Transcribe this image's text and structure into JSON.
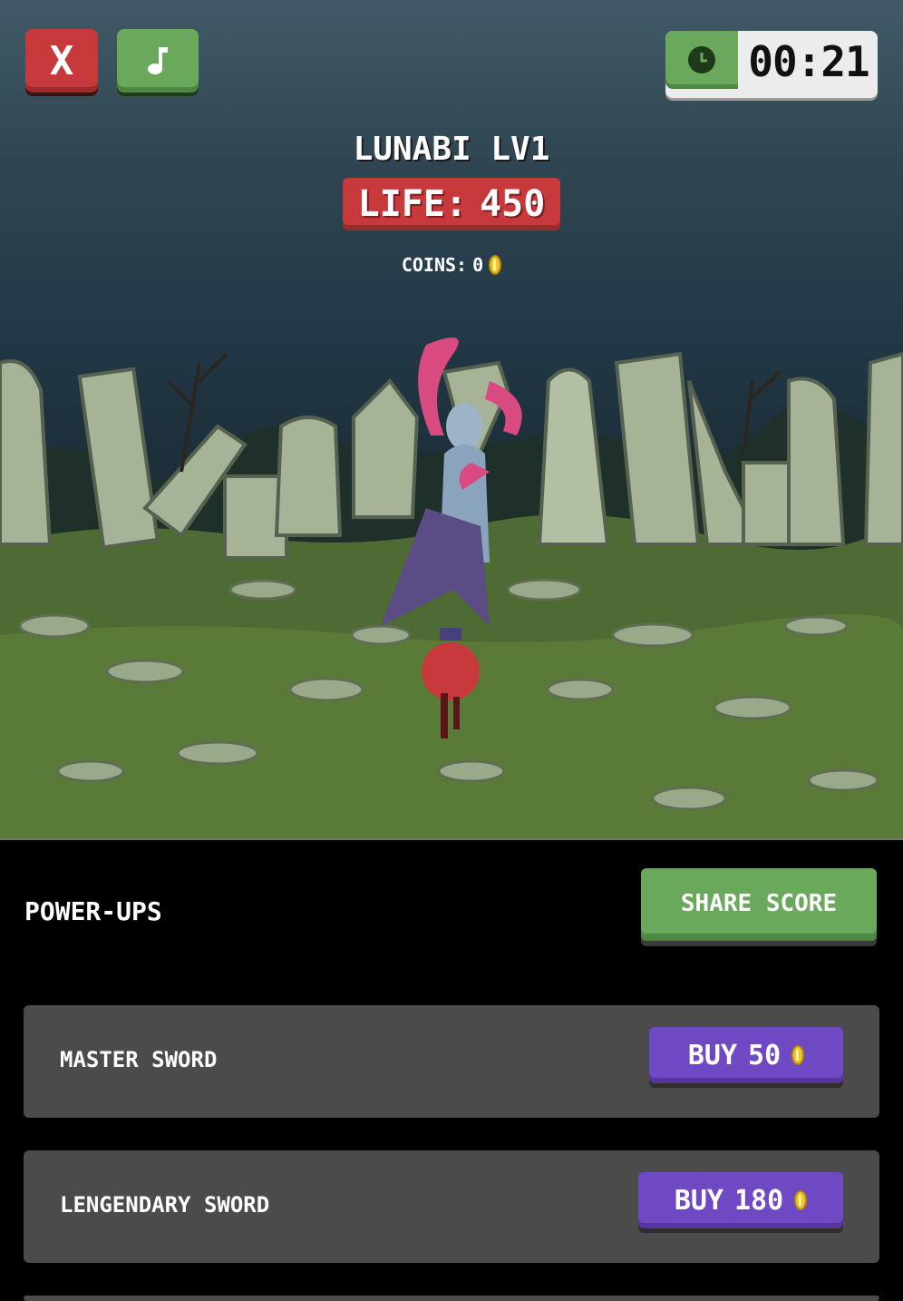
{
  "hud": {
    "close_label": "X",
    "music_icon": "music-note-icon",
    "timer_icon": "clock-icon",
    "timer": "00:21"
  },
  "enemy": {
    "name": "LUNABI LV1",
    "life_label": "LIFE:",
    "life_value": "450"
  },
  "player": {
    "coins_label": "COINS:",
    "coins_value": "0"
  },
  "panel": {
    "title": "POWER-UPS",
    "share_label": "SHARE SCORE",
    "items": [
      {
        "name": "MASTER SWORD",
        "buy_label": "BUY",
        "price": "50"
      },
      {
        "name": "LENGENDARY SWORD",
        "buy_label": "BUY",
        "price": "180"
      }
    ]
  },
  "colors": {
    "red": "#c8393c",
    "green": "#6aa85b",
    "purple": "#6e49c3",
    "panel_bg": "#000000",
    "item_bg": "#4b4b4b"
  }
}
